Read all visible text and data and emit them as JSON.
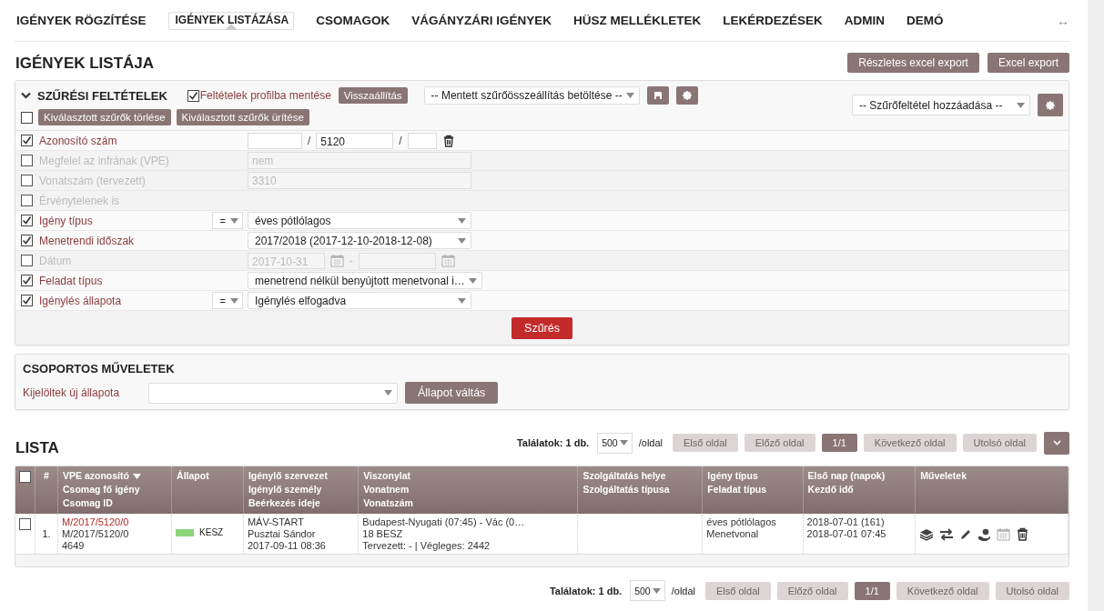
{
  "nav": {
    "items": [
      {
        "label": "IGÉNYEK RÖGZÍTÉSE",
        "selected": false
      },
      {
        "label": "IGÉNYEK LISTÁZÁSA",
        "selected": true
      },
      {
        "label": "CSOMAGOK",
        "selected": false
      },
      {
        "label": "VÁGÁNYZÁRI IGÉNYEK",
        "selected": false
      },
      {
        "label": "HÜSZ MELLÉKLETEK",
        "selected": false
      },
      {
        "label": "LEKÉRDEZÉSEK",
        "selected": false
      },
      {
        "label": "ADMIN",
        "selected": false
      },
      {
        "label": "DEMÓ",
        "selected": false
      }
    ],
    "expand_glyph": "↔"
  },
  "page_title": "IGÉNYEK LISTÁJA",
  "export_buttons": [
    "Részletes excel export",
    "Excel export"
  ],
  "filter_panel": {
    "title": "SZŰRÉSI FELTÉTELEK",
    "expanded": true,
    "save_profile": {
      "label": "Feltételek profilba mentése",
      "checked": true
    },
    "reset_button": "Visszaállítás",
    "saved_filter": {
      "value": "-- Mentett szűrőösszeállítás betöltése --"
    },
    "add_filter": {
      "value": "-- Szűrőfeltétel hozzáadása --"
    },
    "select_all": {
      "checked": false
    },
    "clear_buttons": [
      "Kiválasztott szűrők törlése",
      "Kiválasztott szűrők ürítése"
    ],
    "rows": [
      {
        "kind": "triple",
        "label": "Azonosító szám",
        "checked": true,
        "value": "5120",
        "separator": "/"
      },
      {
        "kind": "text",
        "label": "Megfelel az infrának (VPE)",
        "checked": false,
        "value": "nem"
      },
      {
        "kind": "text",
        "label": "Vonatszám (tervezett)",
        "checked": false,
        "value": "3310"
      },
      {
        "kind": "flag",
        "label": "Érvénytelenek is",
        "checked": false
      },
      {
        "kind": "select",
        "label": "Igény típus",
        "checked": true,
        "operator": "=",
        "value": "éves pótlólagos"
      },
      {
        "kind": "select",
        "label": "Menetrendi időszak",
        "checked": true,
        "value": "2017/2018 (2017-12-10-2018-12-08)"
      },
      {
        "kind": "daterange",
        "label": "Dátum",
        "checked": false,
        "from": "2017-10-31",
        "separator": "-"
      },
      {
        "kind": "select",
        "label": "Feladat típus",
        "checked": true,
        "value": "menetrend nélkül benyújtott menetvonal i…"
      },
      {
        "kind": "select",
        "label": "Igénylés állapota",
        "checked": true,
        "operator": "=",
        "value": "Igénylés elfogadva"
      }
    ],
    "submit_button": "Szűrés"
  },
  "bulk_panel": {
    "title": "CSOPORTOS MŰVELETEK",
    "label": "Kijelöltek új állapota",
    "button": "Állapot váltás"
  },
  "list": {
    "title": "LISTA",
    "pagination_top": {
      "count": "Találatok: 1 db.",
      "page_size": "500",
      "per_page": "/oldal",
      "buttons": [
        {
          "label": "Első oldal",
          "kind": "nav",
          "disabled": true
        },
        {
          "label": "Előző oldal",
          "kind": "nav",
          "disabled": true
        },
        {
          "label": "1/1",
          "kind": "current"
        },
        {
          "label": "Következő oldal",
          "kind": "nav",
          "disabled": true
        },
        {
          "label": "Utolsó oldal",
          "kind": "nav",
          "disabled": true
        }
      ]
    },
    "table": {
      "select_all": {
        "checked": false
      },
      "columns": [
        {
          "lines": [
            "#"
          ]
        },
        {
          "lines": [
            "VPE azonosító",
            "Csomag fő igény",
            "Csomag ID"
          ],
          "sorted": true
        },
        {
          "lines": [
            "Állapot"
          ]
        },
        {
          "lines": [
            "Igénylő szervezet",
            "Igénylő személy",
            "Beérkezés ideje"
          ]
        },
        {
          "lines": [
            "Viszonylat",
            "Vonatnem",
            "Vonatszám"
          ]
        },
        {
          "lines": [
            "Szolgáltatás helye",
            "Szolgáltatás típusa"
          ]
        },
        {
          "lines": [
            "Igény típus",
            "Feladat típus"
          ]
        },
        {
          "lines": [
            "Első nap (napok)",
            "Kezdő idő"
          ]
        },
        {
          "lines": [
            "Műveletek"
          ]
        }
      ],
      "rows": [
        {
          "selected": false,
          "number": "1.",
          "vpe": [
            "M/2017/5120/0",
            "M/2017/5120/0",
            "4649"
          ],
          "status": {
            "label": "KESZ",
            "color": "#8ed47a"
          },
          "requester": [
            "MÁV-START",
            "Pusztai Sándor",
            "2017-09-11 08:36"
          ],
          "route": [
            "Budapest-Nyugati (07:45) - Vác (0…",
            "18 BESZ",
            "Tervezett: - | Végleges: 2442"
          ],
          "type": [
            "éves pótlólagos",
            "Menetvonal"
          ],
          "first_day": [
            "2018-07-01 (161)",
            "2018-07-01 07:45"
          ]
        }
      ]
    },
    "pagination_bottom": {
      "count": "Találatok: 1 db.",
      "page_size": "500",
      "per_page": "/oldal",
      "buttons": [
        {
          "label": "Első oldal",
          "kind": "nav",
          "disabled": true
        },
        {
          "label": "Előző oldal",
          "kind": "nav",
          "disabled": true
        },
        {
          "label": "1/1",
          "kind": "current"
        },
        {
          "label": "Következő oldal",
          "kind": "nav",
          "disabled": true
        },
        {
          "label": "Utolsó oldal",
          "kind": "nav",
          "disabled": true
        }
      ]
    }
  }
}
